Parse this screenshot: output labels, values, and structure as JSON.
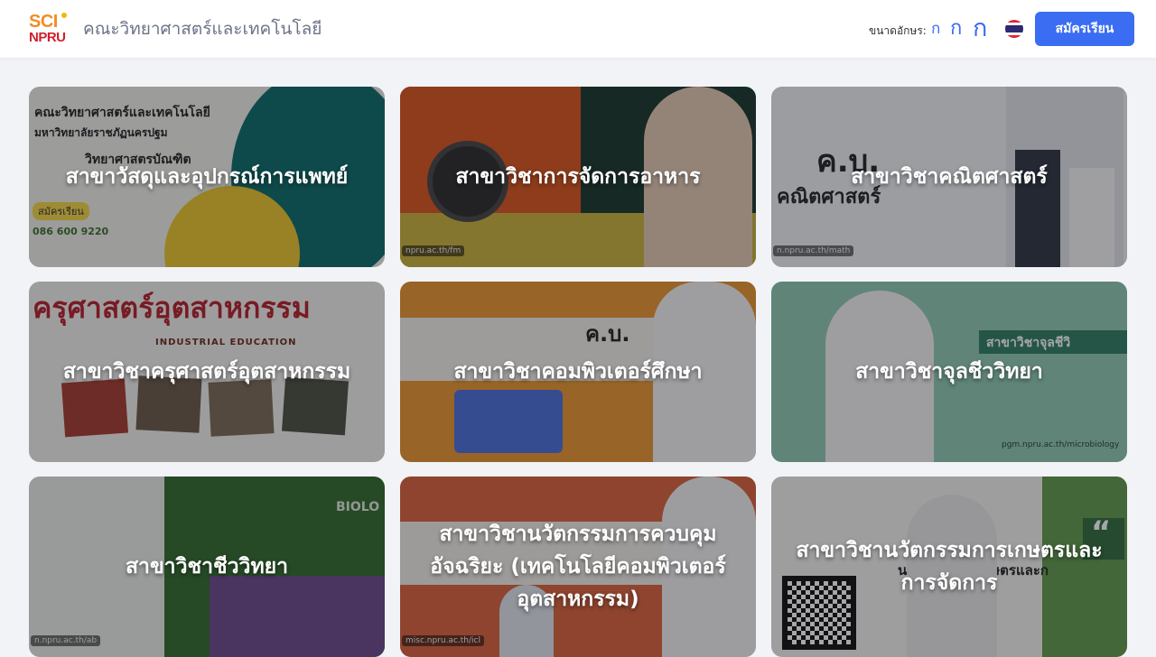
{
  "header": {
    "logo": {
      "top": "SCI",
      "bottom": "NPRU"
    },
    "title": "คณะวิทยาศาสตร์และเทคโนโลยี",
    "font_size_label": "ขนาดอักษร:",
    "font_size_small": "ก",
    "font_size_medium": "ก",
    "font_size_large": "ก",
    "flag_icon": "thai-flag-icon",
    "apply_button": "สมัครเรียน"
  },
  "colors": {
    "accent": "#3b6df2",
    "title_text": "#6b7386",
    "page_bg": "#f2f3f7"
  },
  "programs": [
    {
      "name": "สาขาวัสดุและอุปกรณ์การแพทย์"
    },
    {
      "name": "สาขาวิชาการจัดการอาหาร"
    },
    {
      "name": "สาขาวิชาคณิตศาสตร์"
    },
    {
      "name": "สาขาวิชาครุศาสตร์อุตสาหกรรม"
    },
    {
      "name": "สาขาวิชาคอมพิวเตอร์ศึกษา"
    },
    {
      "name": "สาขาวิชาจุลชีววิทยา"
    },
    {
      "name": "สาขาวิชาชีววิทยา"
    },
    {
      "name": "สาขาวิชานวัตกรรมการควบคุมอัจฉริยะ (เทคโนโลยีคอมพิวเตอร์อุตสาหกรรม)"
    },
    {
      "name": "สาขาวิชานวัตกรรมการเกษตรและการจัดการ"
    }
  ],
  "card_texts": {
    "c1": {
      "l1": "คณะวิทยาศาสตร์และเทคโนโลยี",
      "l2": "มหาวิทยาลัยราชภัฏนครปฐม",
      "l3": "วิทยาศาสตรบัณฑิต",
      "badge": "สมัครเรียน",
      "phone": "086 600 9220"
    },
    "c2": {
      "url": "npru.ac.th/fm"
    },
    "c3": {
      "big": "ค.บ.",
      "sub": "คณิตศาสตร์",
      "url": "n.npru.ac.th/math"
    },
    "c4": {
      "big": "ครุศาสตร์อุตสาหกรรม",
      "sub": "INDUSTRIAL EDUCATION"
    },
    "c5": {
      "big": "ค.บ."
    },
    "c6": {
      "banner": "สาขาวิชาจุลชีวิ",
      "url": "pgm.npru.ac.th/microbiology"
    },
    "c7": {
      "top": "BIOLO",
      "url": "n.npru.ac.th/ab"
    },
    "c8": {
      "url": "misc.npru.ac.th/icl"
    },
    "c9": {
      "quote": "“",
      "banner": "นวัตกรรมการเกษตรและก"
    }
  }
}
